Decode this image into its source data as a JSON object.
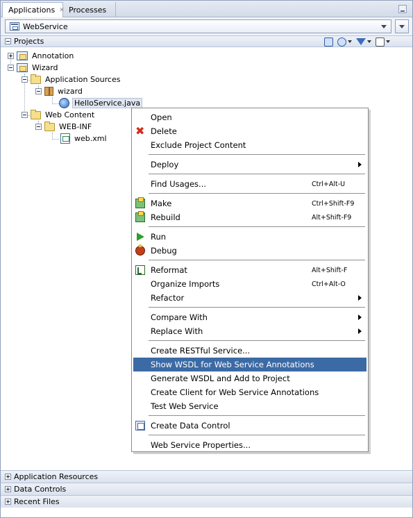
{
  "tabs": [
    {
      "label": "Applications",
      "active": true
    },
    {
      "label": "Processes",
      "active": false
    }
  ],
  "application": {
    "selected": "WebService"
  },
  "projects_header": {
    "label": "Projects"
  },
  "tree": {
    "annotation": "Annotation",
    "wizard": "Wizard",
    "application_sources": "Application Sources",
    "wizard_package": "wizard",
    "hello_service": "HelloService.java",
    "web_content": "Web Content",
    "web_inf": "WEB-INF",
    "web_xml": "web.xml"
  },
  "context_menu": {
    "items": [
      {
        "label": "Open",
        "accel": ""
      },
      {
        "label": "Delete",
        "accel": ""
      },
      {
        "label": "Exclude Project Content",
        "accel": ""
      },
      {
        "label": "Deploy",
        "accel": "",
        "submenu": true
      },
      {
        "label": "Find Usages...",
        "accel": "Ctrl+Alt-U"
      },
      {
        "label": "Make",
        "accel": "Ctrl+Shift-F9"
      },
      {
        "label": "Rebuild",
        "accel": "Alt+Shift-F9"
      },
      {
        "label": "Run",
        "accel": ""
      },
      {
        "label": "Debug",
        "accel": ""
      },
      {
        "label": "Reformat",
        "accel": "Alt+Shift-F"
      },
      {
        "label": "Organize Imports",
        "accel": "Ctrl+Alt-O"
      },
      {
        "label": "Refactor",
        "accel": "",
        "submenu": true
      },
      {
        "label": "Compare With",
        "accel": "",
        "submenu": true
      },
      {
        "label": "Replace With",
        "accel": "",
        "submenu": true
      },
      {
        "label": "Create RESTful Service...",
        "accel": ""
      },
      {
        "label": "Show WSDL for Web Service Annotations",
        "accel": "",
        "highlighted": true
      },
      {
        "label": "Generate WSDL and Add to Project",
        "accel": ""
      },
      {
        "label": "Create Client for Web Service Annotations",
        "accel": ""
      },
      {
        "label": "Test Web Service",
        "accel": ""
      },
      {
        "label": "Create Data Control",
        "accel": ""
      },
      {
        "label": "Web Service Properties...",
        "accel": ""
      }
    ]
  },
  "accordions": [
    {
      "label": "Application Resources"
    },
    {
      "label": "Data Controls"
    },
    {
      "label": "Recent Files"
    }
  ],
  "colors": {
    "menu_highlight": "#3c6aa5",
    "panel_header": "#dbe2ee"
  }
}
